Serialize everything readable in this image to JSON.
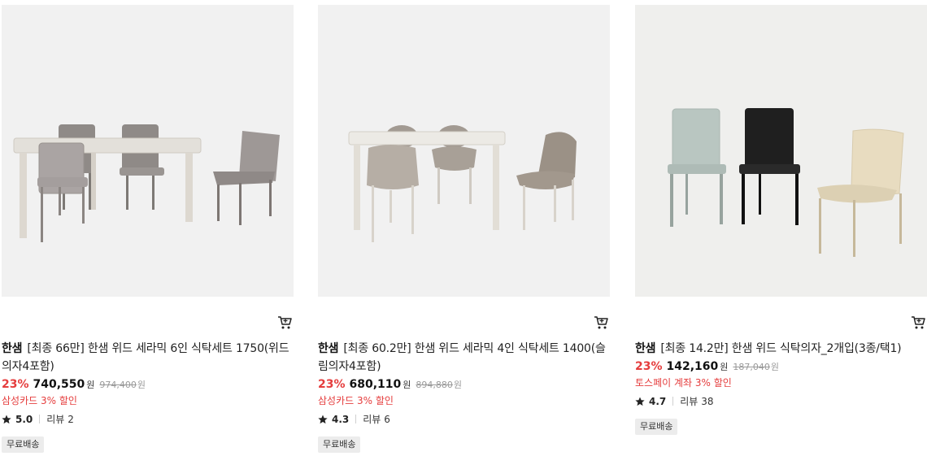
{
  "products": [
    {
      "brand": "한샘",
      "title": "[최종 66만] 한샘 위드 세라믹 6인 식탁세트 1750(위드의자4포함)",
      "discount": "23%",
      "price": "740,550",
      "currency": "원",
      "original_price": "974,400",
      "original_currency": "원",
      "promo": "삼성카드 3% 할인",
      "rating": "5.0",
      "review_label": "리뷰",
      "review_count": "2",
      "badge": "무료배송",
      "image_icon": "dining-table-6-chairs-image",
      "cart_icon": "cart-icon"
    },
    {
      "brand": "한샘",
      "title": "[최종 60.2만] 한샘 위드 세라믹 4인 식탁세트 1400(슬림의자4포함)",
      "discount": "23%",
      "price": "680,110",
      "currency": "원",
      "original_price": "894,880",
      "original_currency": "원",
      "promo": "삼성카드 3% 할인",
      "rating": "4.3",
      "review_label": "리뷰",
      "review_count": "6",
      "badge": "무료배송",
      "image_icon": "dining-table-4-chairs-image",
      "cart_icon": "cart-icon"
    },
    {
      "brand": "한샘",
      "title": "[최종 14.2만] 한샘 위드 식탁의자_2개입(3종/택1)",
      "discount": "23%",
      "price": "142,160",
      "currency": "원",
      "original_price": "187,040",
      "original_currency": "원",
      "promo": "토스페이 계좌 3% 할인",
      "rating": "4.7",
      "review_label": "리뷰",
      "review_count": "38",
      "badge": "무료배송",
      "image_icon": "dining-chairs-image",
      "cart_icon": "cart-icon"
    }
  ],
  "colors": {
    "discount": "#e53d3d",
    "promo": "#e53d3d",
    "badge_bg": "#ececec",
    "image_bg": "#f1f1f1"
  }
}
